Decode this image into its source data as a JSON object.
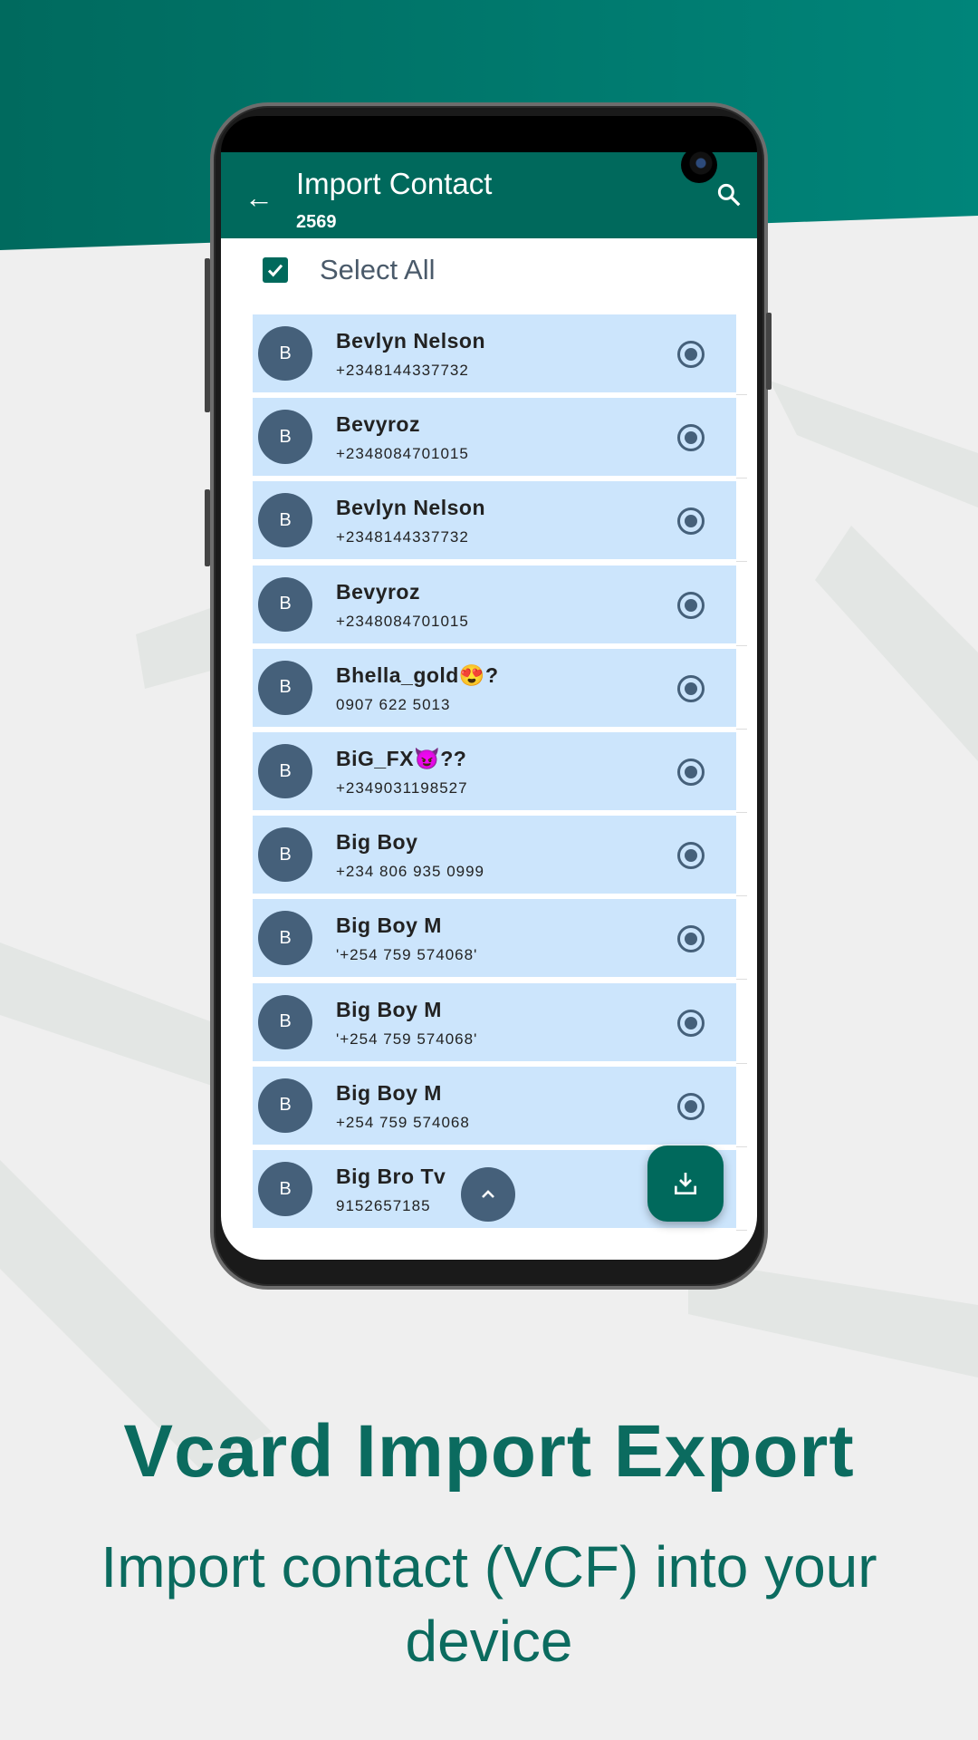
{
  "colors": {
    "primary": "#00695c",
    "row_bg": "#cce5fc",
    "avatar": "#45607a",
    "headline": "#0b6b5f"
  },
  "appbar": {
    "back_icon": "arrow-left-icon",
    "title": "Import Contact",
    "count": "2569",
    "search_icon": "search-icon"
  },
  "select_all": {
    "label": "Select All",
    "checked": true
  },
  "contacts": [
    {
      "initial": "B",
      "name": "Bevlyn Nelson",
      "phone": "+2348144337732",
      "selected": true
    },
    {
      "initial": "B",
      "name": "Bevyroz",
      "phone": "+2348084701015",
      "selected": true
    },
    {
      "initial": "B",
      "name": "Bevlyn Nelson",
      "phone": "+2348144337732",
      "selected": true
    },
    {
      "initial": "B",
      "name": "Bevyroz",
      "phone": "+2348084701015",
      "selected": true
    },
    {
      "initial": "B",
      "name": "Bhella_gold😍?",
      "phone": "0907 622 5013",
      "selected": true
    },
    {
      "initial": "B",
      "name": "BiG_FX😈??",
      "phone": "+2349031198527",
      "selected": true
    },
    {
      "initial": "B",
      "name": "Big Boy",
      "phone": "+234 806 935 0999",
      "selected": true
    },
    {
      "initial": "B",
      "name": "Big Boy M",
      "phone": "'+254 759 574068'",
      "selected": true
    },
    {
      "initial": "B",
      "name": "Big Boy M",
      "phone": "'+254 759 574068'",
      "selected": true
    },
    {
      "initial": "B",
      "name": "Big Boy M",
      "phone": "+254 759 574068",
      "selected": true
    },
    {
      "initial": "B",
      "name": "Big Bro Tv",
      "phone": "9152657185",
      "selected": true
    }
  ],
  "fab": {
    "icon": "download-icon"
  },
  "scroll_top": {
    "icon": "chevron-up-icon"
  },
  "promo": {
    "headline": "Vcard Import Export",
    "subtitle": "Import contact (VCF) into your device"
  }
}
